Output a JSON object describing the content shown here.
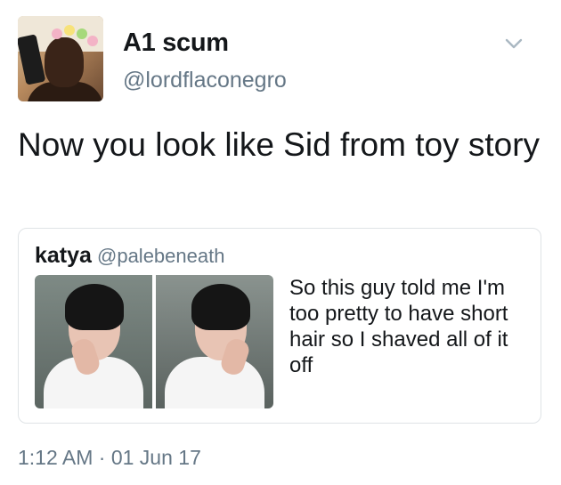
{
  "author": {
    "display_name": "A1 scum",
    "handle": "@lordflaconegro"
  },
  "tweet": {
    "text": "Now you look like Sid from toy story",
    "timestamp": "1:12 AM · 01 Jun 17"
  },
  "quoted_tweet": {
    "display_name": "katya",
    "handle": "@palebeneath",
    "text": "So this guy told me I'm too pretty to have short hair so I shaved all of it off"
  },
  "icons": {
    "menu": "chevron-down-icon"
  },
  "colors": {
    "text": "#14171a",
    "secondary_text": "#657786",
    "border": "#dfe3e6"
  }
}
